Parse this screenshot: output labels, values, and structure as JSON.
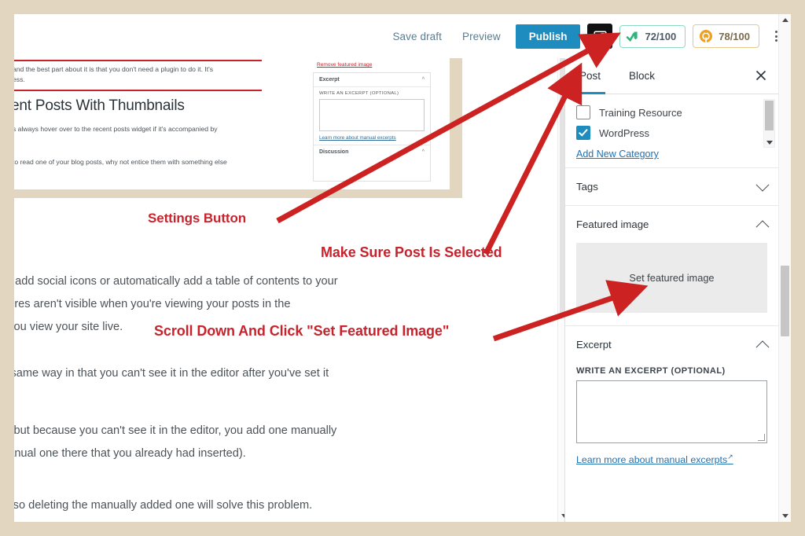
{
  "toolbar": {
    "save_draft": "Save draft",
    "preview": "Preview",
    "publish": "Publish",
    "settings_icon": "sidebar-panel-icon",
    "seo_badge": {
      "icon": "yoast-seo-icon",
      "score": "72/100",
      "color": "#2cb67d"
    },
    "readability_badge": {
      "icon": "wordpress-plugin-icon",
      "score": "78/100",
      "color": "#f0a020"
    },
    "more_icon": "kebab-menu-icon"
  },
  "annotations": [
    {
      "id": "settings",
      "text": "Settings Button"
    },
    {
      "id": "post-selected",
      "text": "Make Sure Post Is Selected"
    },
    {
      "id": "featured",
      "text": "Scroll Down And Click \"Set Featured Image\""
    }
  ],
  "embedded_screenshot": {
    "paragraph_1": "and the best part about it is that you don't need a plugin to do it. It's",
    "paragraph_1b": "ess.",
    "heading": "ent Posts With Thumbnails",
    "paragraph_2": "s always hover over to the recent posts widget if it's accompanied by",
    "paragraph_3": "to read one of your blog posts, why not entice them with something else",
    "panel": {
      "remove_featured_image": "Remove featured image",
      "excerpt_title": "Excerpt",
      "excerpt_label": "WRITE AN EXCERPT (OPTIONAL)",
      "excerpt_link": "Learn more about manual excerpts",
      "discussion_title": "Discussion"
    }
  },
  "editor_body": {
    "paragraph_1_line_1": "utomatically add social icons or automatically add a table of contents to your",
    "paragraph_1_line_2": "t these features aren't visible when you're viewing your posts in the",
    "paragraph_1_line_3": "here when you view your site live.",
    "paragraph_2": "n the exact same way in that you can't see it in the editor after you've set it",
    "paragraph_3_line_1": "ge correctly but because you can't see it in the editor, you add one manually",
    "paragraph_3_line_2": "eave the manual one there that you already had inserted).",
    "paragraph_4": "mage issue so deleting the manually added one will solve this problem."
  },
  "panel": {
    "tabs": [
      {
        "label": "Post",
        "active": true
      },
      {
        "label": "Block",
        "active": false
      }
    ],
    "close_icon": "close-icon",
    "categories": [
      {
        "label": "Training Resource",
        "checked": false
      },
      {
        "label": "WordPress",
        "checked": true
      }
    ],
    "add_new_category": "Add New Category",
    "sections": [
      {
        "id": "tags",
        "title": "Tags",
        "state": "collapsed"
      },
      {
        "id": "featured-image",
        "title": "Featured image",
        "state": "expanded"
      },
      {
        "id": "excerpt",
        "title": "Excerpt",
        "state": "expanded"
      }
    ],
    "set_featured_image": "Set featured image",
    "excerpt_label": "WRITE AN EXCERPT (OPTIONAL)",
    "excerpt_value": "",
    "excerpt_link": "Learn more about manual excerpts",
    "external_link_icon": "external-link-icon"
  },
  "colors": {
    "page_border": "#e2d6c0",
    "accent_blue": "#1e8cbe",
    "annotation_red": "#c8232c",
    "link_blue": "#2271b1"
  }
}
